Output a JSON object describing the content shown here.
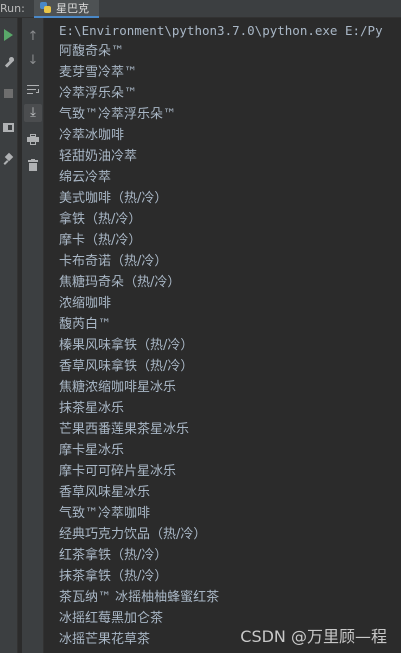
{
  "run_panel": {
    "label": "Run:",
    "tab_label": "星巴克"
  },
  "console": {
    "command": "E:\\Environment\\python3.7.0\\python.exe E:/Py",
    "lines": [
      "阿馥奇朵™",
      "麦芽雪冷萃™",
      "冷萃浮乐朵™",
      "气致™冷萃浮乐朵™",
      "冷萃冰咖啡",
      "轻甜奶油冷萃",
      "绵云冷萃",
      "美式咖啡（热/冷）",
      "拿铁（热/冷）",
      "摩卡（热/冷）",
      "卡布奇诺（热/冷）",
      "焦糖玛奇朵（热/冷）",
      "浓缩咖啡",
      "馥芮白™",
      "榛果风味拿铁（热/冷）",
      "香草风味拿铁（热/冷）",
      "焦糖浓缩咖啡星冰乐",
      "抹茶星冰乐",
      "芒果西番莲果茶星冰乐",
      "摩卡星冰乐",
      "摩卡可可碎片星冰乐",
      "香草风味星冰乐",
      "气致™冷萃咖啡",
      "经典巧克力饮品（热/冷）",
      "红茶拿铁（热/冷）",
      "抹茶拿铁（热/冷）",
      "茶瓦纳™ 冰摇柚柚蜂蜜红茶",
      "冰摇红莓黑加仑茶",
      "冰摇芒果花草茶"
    ]
  },
  "watermark": "CSDN @万里顾—程"
}
